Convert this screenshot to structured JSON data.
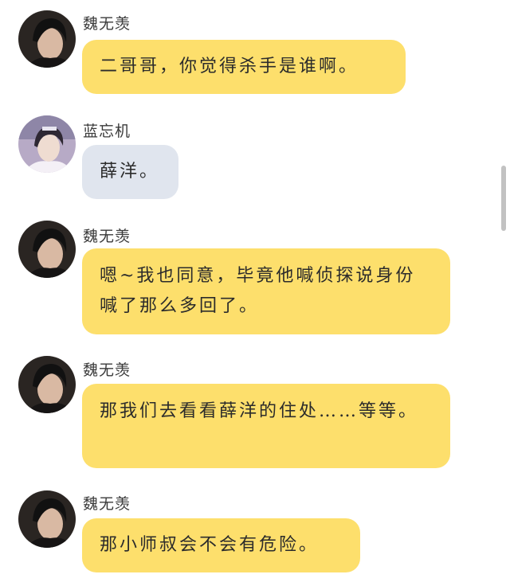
{
  "colors": {
    "yellow_bubble": "#fddf6c",
    "blue_bubble": "#e0e5ee",
    "background": "#ffffff"
  },
  "messages": [
    {
      "sender": "魏无羡",
      "avatar": "dark-portrait-avatar",
      "bubble_style": "yellow",
      "text": "二哥哥，你觉得杀手是谁啊。"
    },
    {
      "sender": "蓝忘机",
      "avatar": "light-costume-portrait-avatar",
      "bubble_style": "blue",
      "text": "薛洋。"
    },
    {
      "sender": "魏无羡",
      "avatar": "dark-portrait-avatar",
      "bubble_style": "yellow",
      "text": "嗯~我也同意，毕竟他喊侦探说身份喊了那么多回了。"
    },
    {
      "sender": "魏无羡",
      "avatar": "dark-portrait-avatar",
      "bubble_style": "yellow",
      "text": "那我们去看看薛洋的住处……等等。"
    },
    {
      "sender": "魏无羡",
      "avatar": "dark-portrait-avatar",
      "bubble_style": "yellow",
      "text": "那小师叔会不会有危险。"
    }
  ]
}
